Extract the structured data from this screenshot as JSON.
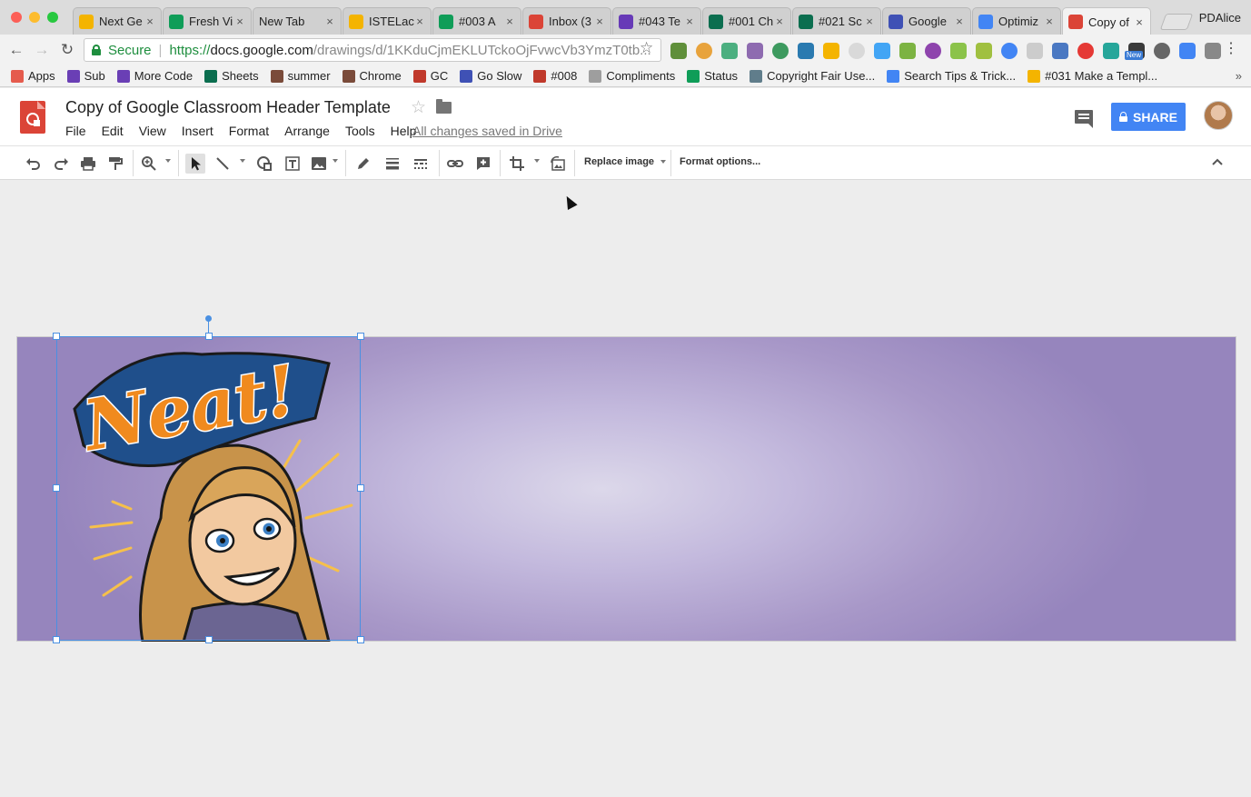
{
  "browser": {
    "profile_name": "PDAlice",
    "tabs": [
      {
        "label": "Next Ge",
        "favicon_color": "#f4b400",
        "favicon": "chrome-icon"
      },
      {
        "label": "Fresh Vi",
        "favicon_color": "#0f9d58",
        "favicon": "sheets-icon"
      },
      {
        "label": "New Tab",
        "favicon_color": "",
        "favicon": ""
      },
      {
        "label": "ISTELac",
        "favicon_color": "#f4b400",
        "favicon": "slides-icon"
      },
      {
        "label": "#003 A",
        "favicon_color": "#0f9d58",
        "favicon": "sheets-icon"
      },
      {
        "label": "Inbox (3",
        "favicon_color": "#db4437",
        "favicon": "gmail-icon"
      },
      {
        "label": "#043 Te",
        "favicon_color": "#673ab7",
        "favicon": "classroom-icon"
      },
      {
        "label": "#001 Ch",
        "favicon_color": "#0b6e4f",
        "favicon": "classroom-icon"
      },
      {
        "label": "#021 Sc",
        "favicon_color": "#0b6e4f",
        "favicon": "classroom-icon"
      },
      {
        "label": "Google",
        "favicon_color": "#3f51b5",
        "favicon": "classroom-icon"
      },
      {
        "label": "Optimiz",
        "favicon_color": "#4285f4",
        "favicon": "google-icon"
      },
      {
        "label": "Copy of",
        "favicon_color": "#db4437",
        "favicon": "drawings-icon",
        "active": true
      }
    ],
    "address_bar": {
      "secure_label": "Secure",
      "url_scheme": "https://",
      "url_host": "docs.google.com",
      "url_path": "/drawings/d/1KKduCjmEKLUTckoOjFvwcVb3YmzT0tb..."
    },
    "extension_colors": [
      "#5f8f3a",
      "#e8a33c",
      "#4caf80",
      "#8e6bb0",
      "#3d9a5f",
      "#2a7ab0",
      "#f4b400",
      "#d9d9d9",
      "#42a5f5",
      "#7cb342",
      "#8e44ad",
      "#8bc34a",
      "#a0c040",
      "#4285f4",
      "#cccccc",
      "#4a78c2",
      "#e53935",
      "#26a69a",
      "#3a3a3a",
      "#666666",
      "#4285f4",
      "#888888"
    ],
    "new_badge": "New",
    "bookmarks": [
      {
        "label": "Apps",
        "color": "#e55b4d"
      },
      {
        "label": "Sub",
        "color": "#6a3fb5"
      },
      {
        "label": "More Code",
        "color": "#6a3fb5"
      },
      {
        "label": "Sheets",
        "color": "#0b6e4f"
      },
      {
        "label": "summer",
        "color": "#7a4b3a"
      },
      {
        "label": "Chrome",
        "color": "#7a4b3a"
      },
      {
        "label": "GC",
        "color": "#c0392b"
      },
      {
        "label": "Go Slow",
        "color": "#3f51b5"
      },
      {
        "label": "#008",
        "color": "#c0392b"
      },
      {
        "label": "Compliments",
        "color": "#9e9e9e"
      },
      {
        "label": "Status",
        "color": "#0f9d58"
      },
      {
        "label": "Copyright Fair Use...",
        "color": "#607d8b"
      },
      {
        "label": "Search Tips & Trick...",
        "color": "#4285f4"
      },
      {
        "label": "#031 Make a Templ...",
        "color": "#f4b400"
      }
    ],
    "bookmarks_overflow": "»"
  },
  "doc": {
    "title": "Copy of Google Classroom Header Template",
    "menu": [
      "File",
      "Edit",
      "View",
      "Insert",
      "Format",
      "Arrange",
      "Tools",
      "Help"
    ],
    "save_status": "All changes saved in Drive",
    "share_label": "SHARE",
    "accent_color": "#4285f4",
    "logo_color": "#db4437"
  },
  "toolbar": {
    "replace_image_label": "Replace image",
    "format_options_label": "Format options...",
    "buttons": [
      "undo-icon",
      "redo-icon",
      "print-icon",
      "paint-format-icon",
      "zoom-icon",
      "select-arrow-icon",
      "line-icon",
      "shape-icon",
      "text-box-icon",
      "image-icon",
      "pen-icon",
      "line-weight-icon",
      "line-dash-icon",
      "link-icon",
      "comment-add-icon",
      "crop-icon",
      "reset-image-icon",
      "collapse-icon"
    ]
  },
  "canvas": {
    "banner_colors": [
      "#dcd8ea",
      "#c3b9dd",
      "#a898c8",
      "#9685bd"
    ],
    "image": {
      "lettering": "Neat!",
      "description": "bitmoji-sticker"
    }
  }
}
